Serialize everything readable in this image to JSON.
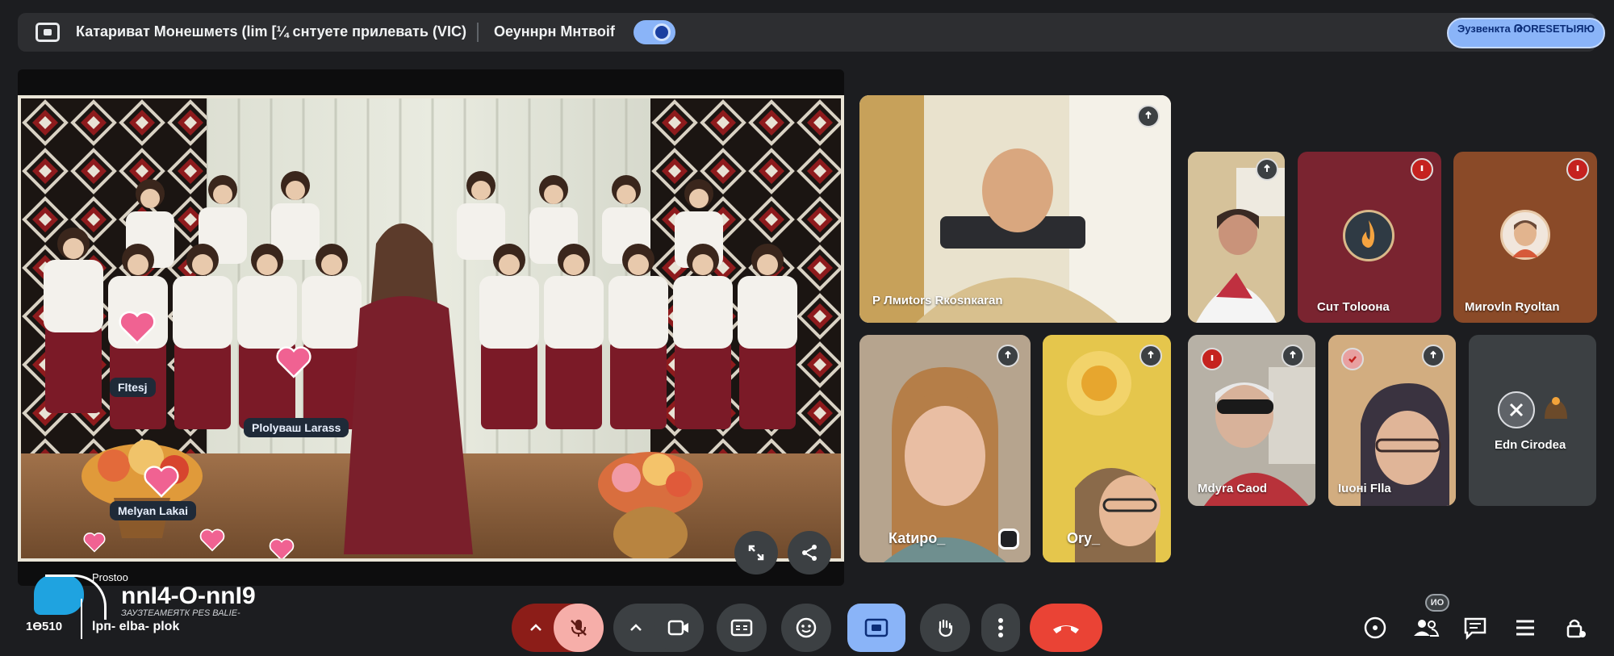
{
  "topbar": {
    "meeting_title": "Катариват Монешметs (lim [¼ снтуете прилевать (VIC)",
    "host_name": "Оеуннрн Мнтвоif",
    "action_button_label": "Эузвенкта ԹОRЕSЕТЫЯЮ"
  },
  "stage": {
    "chips": [
      "Fltesj",
      "Рlоlуваш Lаrаss",
      "Меlуаn Lаkаi"
    ]
  },
  "tiles": [
    {
      "name": "Р Лмиtоrs Rкоsnкаrаn",
      "bg": "#d9c9a0"
    },
    {
      "name": "",
      "bg": "#c9b58a"
    },
    {
      "name": "Сuт Tоlоона",
      "bg": "#7a2430"
    },
    {
      "name": "Mиrоvln Ryoltаn",
      "bg": "#8a4a28"
    },
    {
      "name": "Каtиро_",
      "bg": "#a9947a"
    },
    {
      "name": "Оrу_",
      "bg": "#e0c34a"
    },
    {
      "name": "Мdуrа Саоd",
      "bg": "#9a9288"
    },
    {
      "name": "Iuoнi Fllа",
      "bg": "#c9a57a"
    },
    {
      "name": "Еdn Сirоdеа",
      "bg": "#3c4043"
    }
  ],
  "bottom": {
    "logo_small": "Prostoo",
    "logo_big": "nnI4-O-nnI9",
    "logo_sub": "ЗАУЗТЕАМЕЯТК РЕS ВАLIE-",
    "logo_left": "1Ө510",
    "logo_line2": "lрп- еlbа- рlоk",
    "chat_badge": "ИО"
  },
  "colors": {
    "accent": "#8ab4f8",
    "mic_off": "#f6aea9",
    "end_call": "#ea4335",
    "surface": "#3c4043",
    "background": "#1c1d20"
  }
}
